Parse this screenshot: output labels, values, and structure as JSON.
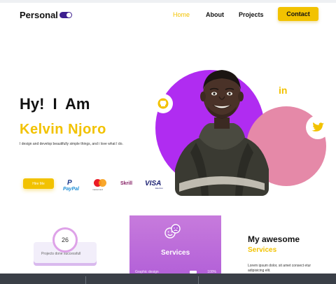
{
  "nav": {
    "logo": "Personal",
    "links": [
      "Home",
      "About",
      "Projects"
    ],
    "contact_label": "Contact"
  },
  "hero": {
    "greeting": "Hy! I  Am",
    "name": "Kelvin Njoro",
    "tagline": "I design and develop beautifully  simple things, and i love what I do.",
    "hire_label": "Hire Me",
    "payments": {
      "paypal": "PayPal",
      "mastercard": "mastercard",
      "skrill": "Skrill",
      "visa": "VISA",
      "visa_sub": "Electron"
    },
    "social": {
      "linkedin": "in"
    }
  },
  "projects": {
    "count": "26",
    "label": "Projects done successfull"
  },
  "services_card": {
    "title": "Services",
    "row_label": "Graphic design",
    "row_pct": "100%"
  },
  "awesome": {
    "title": "My awesome",
    "subtitle": "Services",
    "text": "Lorem ipsum dolor, sit amet consect etur adipisicing elit."
  },
  "colors": {
    "accent": "#f2c200",
    "purple": "#b02cf1",
    "pink": "#e589a8",
    "toggle": "#3d1f8f"
  },
  "icons": [
    "github-icon",
    "linkedin-icon",
    "twitter-icon",
    "emoji-icon"
  ]
}
